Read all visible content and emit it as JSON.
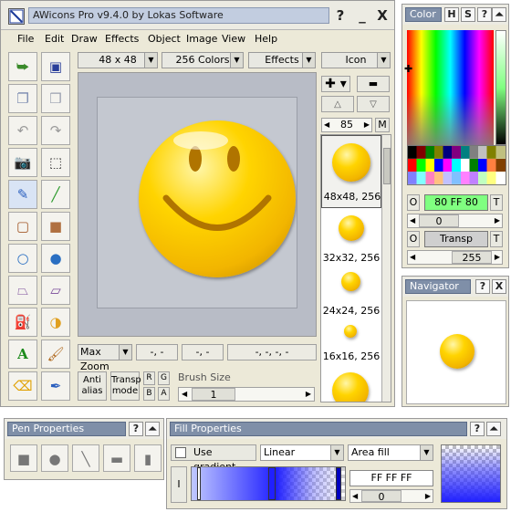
{
  "app": {
    "title": "AWicons Pro v9.4.0 by Lokas Software",
    "help_btn": "?",
    "min_btn": "_",
    "close_btn": "X"
  },
  "menu": [
    "File",
    "Edit",
    "Draw",
    "Effects",
    "Object",
    "Image",
    "View",
    "Help"
  ],
  "toolbar": {
    "size": "48 x 48",
    "colors": "256 Colors",
    "effects": "Effects",
    "icon_type": "Icon"
  },
  "status": {
    "zoom": "Max Zoom",
    "pos": "-, -",
    "size": "-, -",
    "rect": "-, -, -, -",
    "antialias": "Anti alias",
    "transp_mode": "Transp mode",
    "r": "R",
    "g": "G",
    "b": "B",
    "a": "A",
    "brush_label": "Brush Size",
    "brush_value": "1"
  },
  "formats": {
    "count": "85",
    "mode": "M",
    "items": [
      {
        "label": "48x48, 256"
      },
      {
        "label": "32x32, 256"
      },
      {
        "label": "24x24, 256"
      },
      {
        "label": "16x16, 256"
      }
    ]
  },
  "color_panel": {
    "title": "Color",
    "h": "H",
    "s": "S",
    "help": "?",
    "hex": "80 FF 80",
    "o1": "O",
    "t1": "T",
    "slider1": "0",
    "o2": "O",
    "transp": "Transp",
    "t2": "T",
    "slider2": "255",
    "colors": {
      "primary": "#80ff80",
      "transp": "#cfcfcf"
    }
  },
  "navigator": {
    "title": "Navigator",
    "help": "?",
    "close": "X"
  },
  "pen_panel": {
    "title": "Pen Properties",
    "help": "?"
  },
  "fill_panel": {
    "title": "Fill Properties",
    "help": "?",
    "use_gradient": "Use gradient",
    "gradient_type": "Linear",
    "fill_type": "Area fill",
    "hex": "FF FF FF",
    "slider": "0",
    "i_label": "I"
  }
}
